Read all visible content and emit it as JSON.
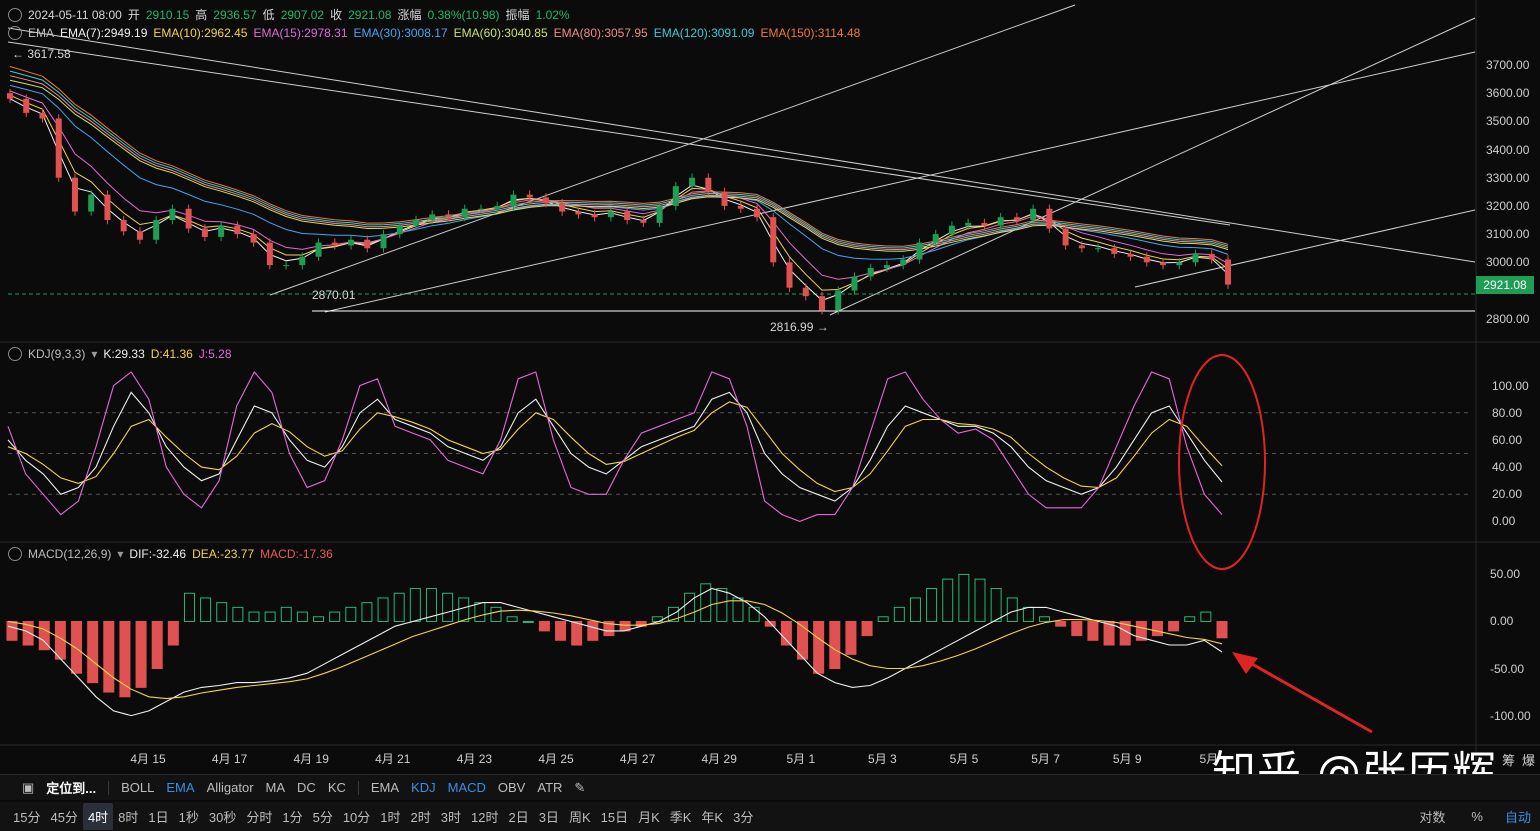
{
  "header": {
    "date": "2024-05-11 08:00",
    "open_label": "开",
    "open": "2910.15",
    "high_label": "高",
    "high": "2936.57",
    "low_label": "低",
    "low": "2907.02",
    "close_label": "收",
    "close": "2921.08",
    "change_label": "涨幅",
    "change": "0.38%(10.98)",
    "amp_label": "振幅",
    "amp": "1.02%"
  },
  "ema_legend": {
    "name": "EMA",
    "items": [
      {
        "label": "EMA(7):2949.19",
        "color": "#f0f0f0"
      },
      {
        "label": "EMA(10):2962.45",
        "color": "#f5d547"
      },
      {
        "label": "EMA(15):2978.31",
        "color": "#e06bd6"
      },
      {
        "label": "EMA(30):3008.17",
        "color": "#4aa3f0"
      },
      {
        "label": "EMA(60):3040.85",
        "color": "#c9e36a"
      },
      {
        "label": "EMA(80):3057.95",
        "color": "#f08a8a"
      },
      {
        "label": "EMA(120):3091.09",
        "color": "#3ec9d6"
      },
      {
        "label": "EMA(150):3114.48",
        "color": "#f07a3a"
      }
    ]
  },
  "kdj_legend": {
    "name": "KDJ(9,3,3)",
    "k": "K:29.33",
    "d": "D:41.36",
    "j": "J:5.28"
  },
  "macd_legend": {
    "name": "MACD(12,26,9)",
    "dif": "DIF:-32.46",
    "dea": "DEA:-23.77",
    "macd": "MACD:-17.36"
  },
  "annotations": {
    "high_marker": "← 3617.58",
    "low1": "2870.01",
    "low2": "2816.99 →",
    "current_price": "2921.08"
  },
  "price_axis": [
    "3700.00",
    "3600.00",
    "3500.00",
    "3400.00",
    "3300.00",
    "3200.00",
    "3100.00",
    "3000.00",
    "2800.00"
  ],
  "kdj_axis": [
    "100.00",
    "80.00",
    "60.00",
    "40.00",
    "20.00",
    "0.00"
  ],
  "macd_axis": [
    "50.00",
    "0.00",
    "-50.00",
    "-100.00"
  ],
  "x_axis": [
    "4月 15",
    "4月 17",
    "4月 19",
    "4月 21",
    "4月 23",
    "4月 25",
    "4月 27",
    "4月 29",
    "5月 1",
    "5月 3",
    "5月 5",
    "5月 7",
    "5月 9",
    "5月"
  ],
  "indicator_bar": {
    "locate": "定位到...",
    "main": [
      "BOLL",
      "EMA",
      "Alligator",
      "MA",
      "DC",
      "KC"
    ],
    "main_active": "EMA",
    "sub": [
      "EMA",
      "KDJ",
      "MACD",
      "OBV",
      "ATR"
    ],
    "sub_active": [
      "KDJ",
      "MACD"
    ]
  },
  "interval_bar": {
    "items": [
      "15分",
      "45分",
      "4时",
      "8时",
      "1日",
      "1秒",
      "30秒",
      "分时",
      "1分",
      "5分",
      "10分",
      "1时",
      "2时",
      "3时",
      "12时",
      "2日",
      "3日",
      "周K",
      "15日",
      "月K",
      "季K",
      "年K",
      "3分"
    ],
    "active": "4时"
  },
  "bottom_right": {
    "log": "对数",
    "pct": "%",
    "auto": "自动"
  },
  "right_labels": {
    "chip": "筹",
    "burst": "爆"
  },
  "watermark": "知乎 @张历辉",
  "chart_data": [
    {
      "type": "candlestick",
      "title": "",
      "ylim": [
        2760,
        3760
      ],
      "x_range": [
        "2024-04-13",
        "2024-05-11 08:00"
      ],
      "interval": "4h",
      "approx_closes": [
        3580,
        3530,
        3510,
        3300,
        3180,
        3240,
        3150,
        3110,
        3080,
        3150,
        3190,
        3120,
        3090,
        3130,
        3100,
        3070,
        2990,
        2990,
        3020,
        3070,
        3060,
        3080,
        3050,
        3100,
        3130,
        3150,
        3170,
        3160,
        3190,
        3190,
        3200,
        3240,
        3230,
        3210,
        3180,
        3170,
        3160,
        3180,
        3150,
        3140,
        3200,
        3270,
        3300,
        3250,
        3200,
        3190,
        3160,
        3000,
        2910,
        2880,
        2830,
        2900,
        2950,
        2980,
        2990,
        3010,
        3070,
        3100,
        3130,
        3140,
        3130,
        3160,
        3150,
        3190,
        3120,
        3060,
        3050,
        3050,
        3030,
        3020,
        3000,
        2990,
        3000,
        3030,
        3010,
        2921
      ],
      "high": 3617.58,
      "low_marks": [
        2870.01,
        2816.99
      ],
      "last_close": 2921.08,
      "ema_series": [
        {
          "name": "EMA(7)",
          "last": 2949.19
        },
        {
          "name": "EMA(10)",
          "last": 2962.45
        },
        {
          "name": "EMA(15)",
          "last": 2978.31
        },
        {
          "name": "EMA(30)",
          "last": 3008.17
        },
        {
          "name": "EMA(60)",
          "last": 3040.85
        },
        {
          "name": "EMA(80)",
          "last": 3057.95
        },
        {
          "name": "EMA(120)",
          "last": 3091.09
        },
        {
          "name": "EMA(150)",
          "last": 3114.48
        }
      ]
    },
    {
      "type": "line",
      "title": "KDJ(9,3,3)",
      "ylim": [
        -10,
        110
      ],
      "guides": [
        80,
        50,
        20
      ],
      "series": [
        {
          "name": "K",
          "values": [
            60,
            45,
            35,
            20,
            25,
            40,
            70,
            95,
            80,
            55,
            40,
            30,
            35,
            60,
            85,
            80,
            60,
            45,
            40,
            55,
            80,
            90,
            75,
            70,
            65,
            55,
            50,
            45,
            55,
            80,
            90,
            70,
            50,
            40,
            35,
            45,
            55,
            60,
            65,
            70,
            90,
            95,
            80,
            50,
            35,
            25,
            20,
            15,
            25,
            45,
            70,
            85,
            80,
            75,
            70,
            70,
            65,
            55,
            40,
            30,
            25,
            20,
            25,
            40,
            60,
            80,
            85,
            65,
            45,
            29
          ]
        },
        {
          "name": "D",
          "values": [
            55,
            50,
            42,
            32,
            28,
            33,
            50,
            70,
            75,
            62,
            50,
            40,
            38,
            48,
            65,
            72,
            66,
            55,
            48,
            52,
            68,
            80,
            77,
            73,
            68,
            60,
            55,
            50,
            53,
            68,
            80,
            75,
            62,
            50,
            42,
            44,
            50,
            56,
            62,
            67,
            80,
            88,
            84,
            67,
            50,
            38,
            28,
            22,
            25,
            35,
            52,
            70,
            75,
            75,
            72,
            71,
            68,
            62,
            50,
            40,
            32,
            26,
            25,
            32,
            48,
            65,
            75,
            70,
            55,
            41
          ]
        },
        {
          "name": "J",
          "values": [
            70,
            35,
            20,
            5,
            15,
            55,
            100,
            110,
            90,
            40,
            20,
            10,
            30,
            85,
            110,
            95,
            50,
            25,
            30,
            60,
            100,
            105,
            70,
            65,
            60,
            45,
            40,
            35,
            60,
            105,
            110,
            60,
            25,
            20,
            20,
            45,
            65,
            70,
            75,
            80,
            110,
            105,
            70,
            15,
            5,
            0,
            5,
            5,
            25,
            65,
            105,
            110,
            90,
            75,
            65,
            68,
            60,
            40,
            20,
            10,
            10,
            10,
            25,
            55,
            85,
            110,
            105,
            55,
            20,
            5
          ]
        }
      ],
      "last_values": {
        "K": 29.33,
        "D": 41.36,
        "J": 5.28
      }
    },
    {
      "type": "bar",
      "title": "MACD(12,26,9)",
      "ylim": [
        -110,
        60
      ],
      "series": [
        {
          "name": "MACD",
          "values": [
            -20,
            -25,
            -30,
            -40,
            -55,
            -65,
            -75,
            -80,
            -70,
            -50,
            -25,
            30,
            25,
            20,
            15,
            10,
            10,
            15,
            10,
            5,
            10,
            15,
            20,
            25,
            30,
            35,
            35,
            30,
            25,
            20,
            15,
            5,
            0,
            -10,
            -20,
            -25,
            -20,
            -15,
            -10,
            -5,
            5,
            15,
            30,
            40,
            35,
            25,
            15,
            -5,
            -25,
            -40,
            -55,
            -50,
            -35,
            -15,
            5,
            15,
            25,
            35,
            45,
            50,
            45,
            35,
            25,
            15,
            5,
            -5,
            -15,
            -20,
            -25,
            -25,
            -20,
            -15,
            -10,
            5,
            10,
            -17.36
          ]
        },
        {
          "name": "DIF",
          "values": [
            -5,
            -10,
            -20,
            -40,
            -60,
            -80,
            -95,
            -100,
            -95,
            -85,
            -75,
            -70,
            -68,
            -65,
            -65,
            -63,
            -60,
            -55,
            -45,
            -35,
            -25,
            -15,
            -5,
            0,
            5,
            10,
            15,
            20,
            20,
            15,
            10,
            5,
            0,
            -5,
            -10,
            -10,
            -5,
            0,
            10,
            25,
            35,
            30,
            20,
            5,
            -15,
            -35,
            -55,
            -65,
            -70,
            -68,
            -60,
            -50,
            -40,
            -30,
            -20,
            -10,
            0,
            10,
            15,
            15,
            10,
            5,
            0,
            -5,
            -15,
            -20,
            -25,
            -25,
            -20,
            -32.46
          ]
        },
        {
          "name": "DEA",
          "values": [
            0,
            -3,
            -8,
            -18,
            -30,
            -45,
            -60,
            -72,
            -80,
            -82,
            -80,
            -76,
            -73,
            -70,
            -68,
            -66,
            -64,
            -61,
            -55,
            -48,
            -40,
            -32,
            -24,
            -16,
            -10,
            -4,
            2,
            7,
            11,
            12,
            11,
            9,
            6,
            2,
            -2,
            -4,
            -4,
            -2,
            3,
            10,
            18,
            22,
            22,
            18,
            9,
            -3,
            -17,
            -30,
            -40,
            -47,
            -50,
            -50,
            -47,
            -42,
            -36,
            -29,
            -21,
            -13,
            -6,
            -1,
            2,
            2,
            1,
            -1,
            -5,
            -9,
            -13,
            -17,
            -19,
            -23.77
          ]
        }
      ]
    }
  ]
}
